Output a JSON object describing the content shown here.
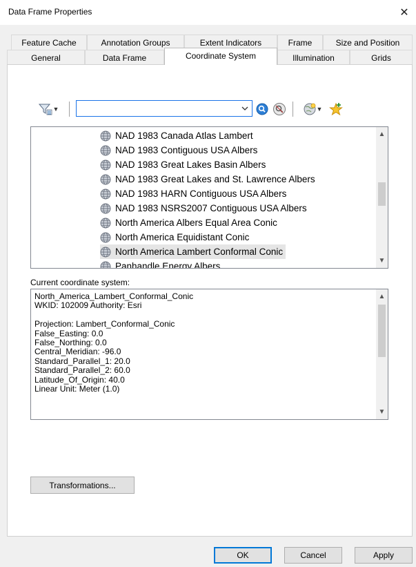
{
  "window": {
    "title": "Data Frame Properties",
    "close_glyph": "✕"
  },
  "tabs_row1": [
    "Feature Cache",
    "Annotation Groups",
    "Extent Indicators",
    "Frame",
    "Size and Position"
  ],
  "tabs_row2": [
    "General",
    "Data Frame",
    "Coordinate System",
    "Illumination",
    "Grids"
  ],
  "active_tab": "Coordinate System",
  "toolbar": {
    "filter_icon": "filter-icon",
    "search_value": "",
    "search_icon": "search-icon",
    "clear_search_icon": "clear-search-icon",
    "globe_icon": "globe-icon",
    "favorites_icon": "add-favorite-icon"
  },
  "coordinate_list": [
    "NAD 1983 Canada Atlas Lambert",
    "NAD 1983 Contiguous USA Albers",
    "NAD 1983 Great Lakes Basin Albers",
    "NAD 1983 Great Lakes and St. Lawrence Albers",
    "NAD 1983 HARN Contiguous USA Albers",
    "NAD 1983 NSRS2007 Contiguous USA Albers",
    "North America Albers Equal Area Conic",
    "North America Equidistant Conic",
    "North America Lambert Conformal Conic",
    "Panhandle Energy Albers"
  ],
  "selected_coordinate": "North America Lambert Conformal Conic",
  "current_label": "Current coordinate system:",
  "current_details": [
    "North_America_Lambert_Conformal_Conic",
    "WKID: 102009 Authority: Esri",
    "",
    "Projection: Lambert_Conformal_Conic",
    "False_Easting: 0.0",
    "False_Northing: 0.0",
    "Central_Meridian: -96.0",
    "Standard_Parallel_1: 20.0",
    "Standard_Parallel_2: 60.0",
    "Latitude_Of_Origin: 40.0",
    "Linear Unit: Meter (1.0)"
  ],
  "buttons": {
    "transformations": "Transformations...",
    "ok": "OK",
    "cancel": "Cancel",
    "apply": "Apply"
  },
  "colors": {
    "accent": "#0078d7",
    "selection": "#e5e5e5",
    "dialog_bg": "#f0f0f0"
  }
}
